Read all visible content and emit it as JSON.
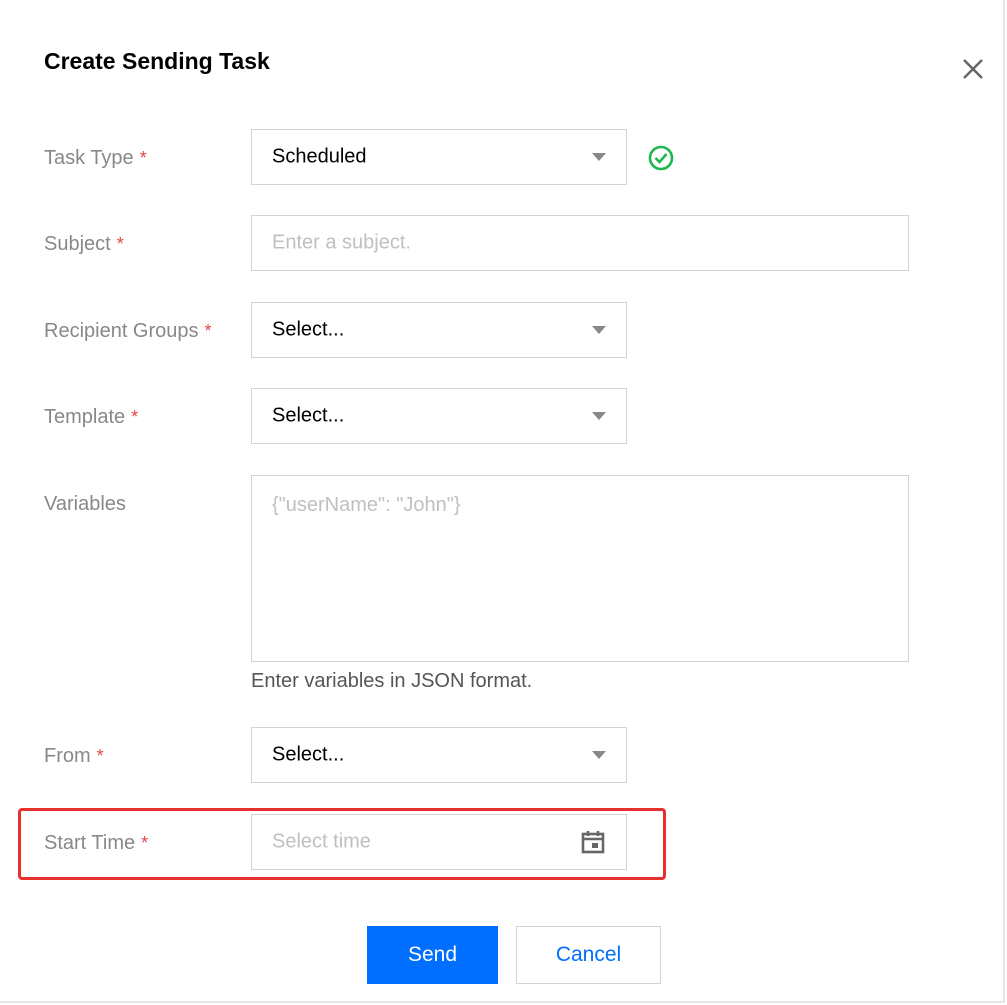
{
  "dialog": {
    "title": "Create Sending Task"
  },
  "form": {
    "task_type": {
      "label": "Task Type",
      "required": "*",
      "value": "Scheduled"
    },
    "subject": {
      "label": "Subject",
      "required": "*",
      "placeholder": "Enter a subject."
    },
    "recipient_groups": {
      "label": "Recipient Groups",
      "required": "*",
      "value": "Select..."
    },
    "template": {
      "label": "Template",
      "required": "*",
      "value": "Select..."
    },
    "variables": {
      "label": "Variables",
      "placeholder": "{\"userName\": \"John\"}",
      "hint": "Enter variables in JSON format."
    },
    "from": {
      "label": "From",
      "required": "*",
      "value": "Select..."
    },
    "start_time": {
      "label": "Start Time",
      "required": "*",
      "placeholder": "Select time"
    }
  },
  "buttons": {
    "send": "Send",
    "cancel": "Cancel"
  },
  "icons": {
    "close": "close-icon",
    "valid": "check-circle-icon",
    "calendar": "calendar-icon",
    "dropdown": "chevron-down-icon"
  },
  "colors": {
    "primary": "#006eff",
    "required": "#e54545",
    "valid": "#1db74d",
    "highlight": "#e8312f"
  }
}
